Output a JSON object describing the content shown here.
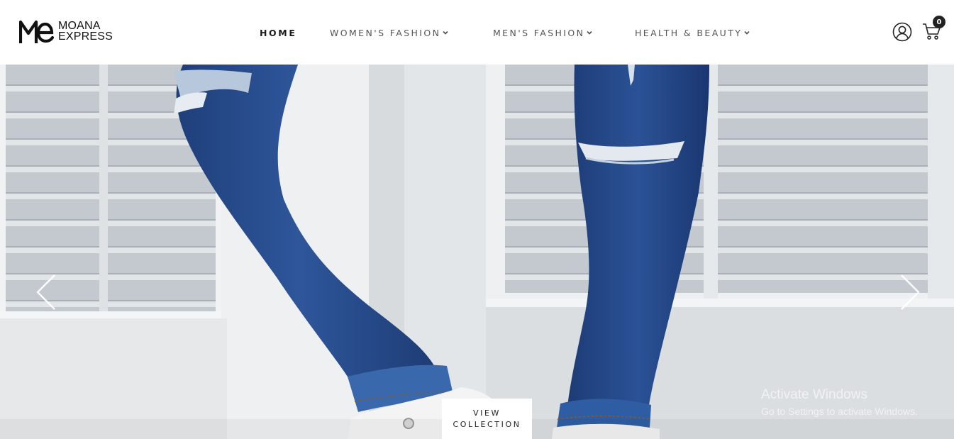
{
  "brand": {
    "logo_mark_icon": "me-monogram-icon",
    "line1": "MOANA",
    "line2": "EXPRESS"
  },
  "nav": {
    "items": [
      {
        "label": "HOME",
        "active": true,
        "has_dropdown": false
      },
      {
        "label": "WOMEN'S FASHION",
        "active": false,
        "has_dropdown": true
      },
      {
        "label": "MEN'S FASHION",
        "active": false,
        "has_dropdown": true
      },
      {
        "label": "HEALTH & BEAUTY",
        "active": false,
        "has_dropdown": true
      }
    ]
  },
  "header_actions": {
    "account_icon": "user-circle-icon",
    "cart_icon": "shopping-cart-icon",
    "cart_count": "0"
  },
  "hero": {
    "image_subject": "legs in ripped blue jeans and white sneakers",
    "prev_icon": "chevron-left-icon",
    "next_icon": "chevron-right-icon",
    "cta_line1": "VIEW",
    "cta_line2": "COLLECTION"
  },
  "os_watermark": {
    "title": "Activate Windows",
    "subtitle": "Go to Settings to activate Windows."
  },
  "colors": {
    "header_bg": "#ffffff",
    "text_dark": "#1a1a1a",
    "nav_text": "#555555",
    "denim": "#2d4f8f",
    "badge": "#222222"
  }
}
